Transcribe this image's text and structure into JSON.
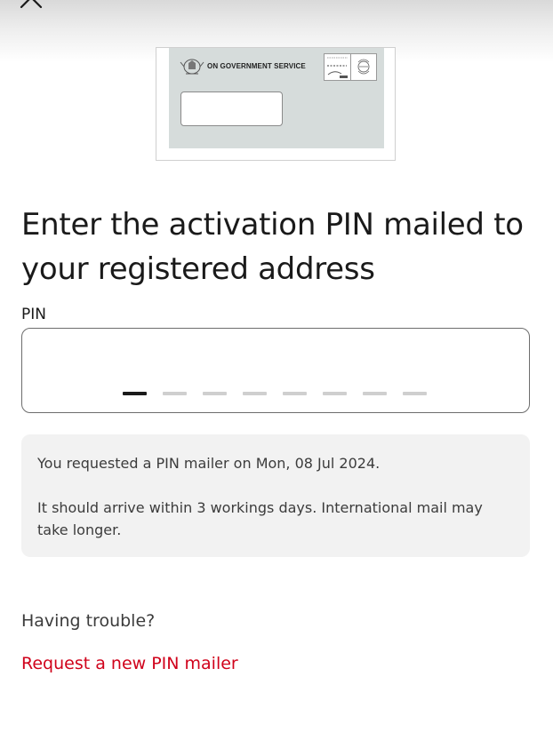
{
  "envelope": {
    "service_text": "ON GOVERNMENT SERVICE"
  },
  "heading": "Enter the activation PIN mailed to your registered address",
  "pin": {
    "label": "PIN",
    "length": 8,
    "filled": 0
  },
  "info": {
    "requested": "You requested a PIN mailer on Mon, 08 Jul 2024.",
    "arrival": "It should arrive within 3 workings days. International mail may take longer."
  },
  "help": {
    "trouble": "Having trouble?",
    "request_link": "Request a new PIN mailer"
  },
  "colors": {
    "accent": "#d0021b",
    "envelope": "#d6dcdb"
  },
  "icons": {
    "close": "close-icon"
  }
}
